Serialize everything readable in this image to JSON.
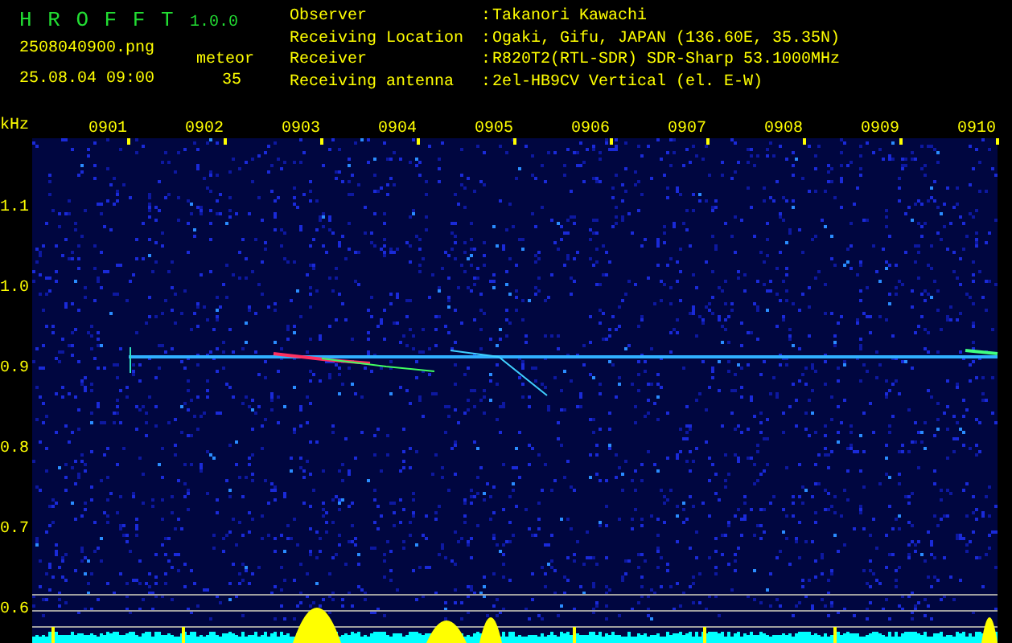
{
  "app": {
    "title": "H R O F F T",
    "version": "1.0.0"
  },
  "file": {
    "filename": "2508040900.png",
    "datetime": "25.08.04 09:00"
  },
  "meteor": {
    "label": "meteor",
    "count": "35"
  },
  "station_info": [
    {
      "label": "Observer",
      "separator": ":",
      "value": "Takanori Kawachi"
    },
    {
      "label": "Receiving Location",
      "separator": ":",
      "value": "Ogaki, Gifu, JAPAN (136.60E, 35.35N)"
    },
    {
      "label": "Receiver",
      "separator": ":",
      "value": "R820T2(RTL-SDR) SDR-Sharp 53.1000MHz"
    },
    {
      "label": "Receiving antenna",
      "separator": ":",
      "value": "2el-HB9CV Vertical (el. E-W)"
    }
  ],
  "chart": {
    "y_unit": "kHz",
    "x_labels": [
      "0901",
      "0902",
      "0903",
      "0904",
      "0905",
      "0906",
      "0907",
      "0908",
      "0909",
      "0910"
    ],
    "y_labels": [
      "1.1",
      "1.0",
      "0.9",
      "0.8",
      "0.7",
      "0.6"
    ]
  }
}
